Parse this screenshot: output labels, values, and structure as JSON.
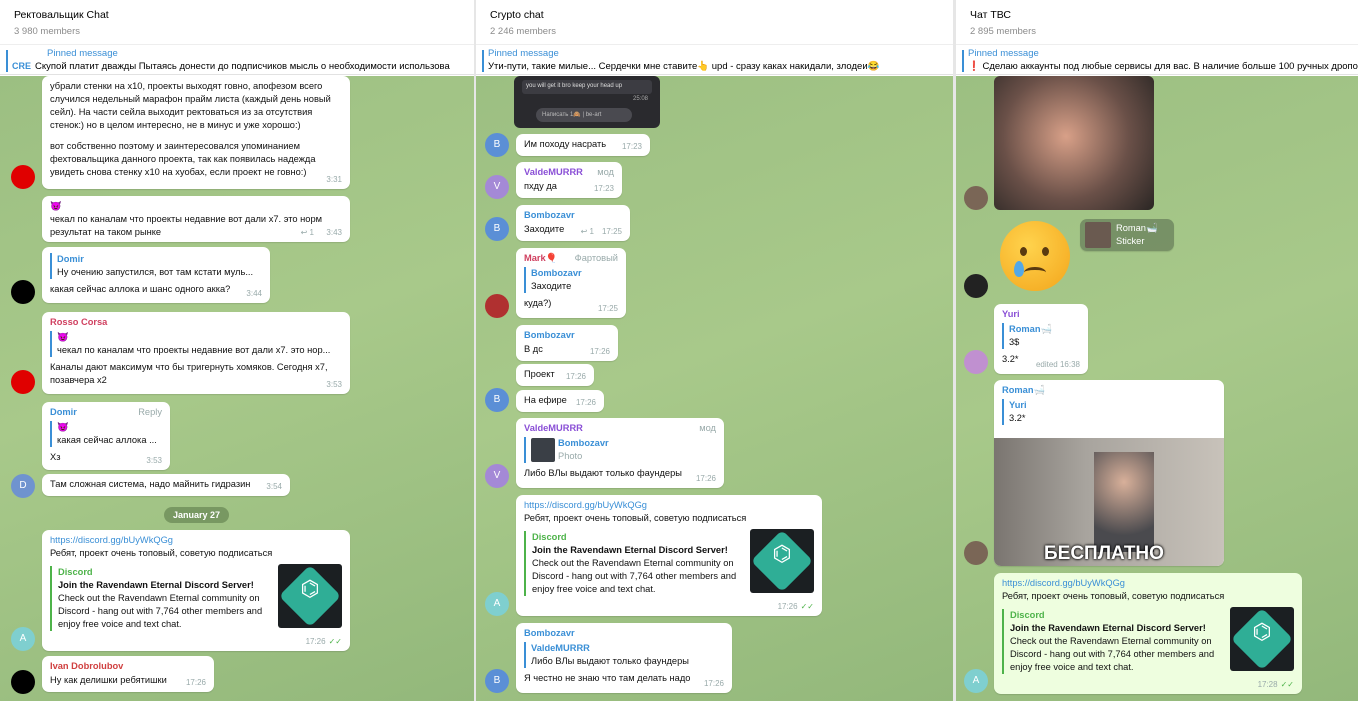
{
  "panel1": {
    "title": "Ректовальщик Chat",
    "members": "3 980 members",
    "pinned_label": "Pinned message",
    "pinned_logo": "CRE",
    "pinned_text": "Скупой платит дважды  Пытаясь донести до подписчиков мысль о необходимости использова",
    "m1_text": "убрали стенки на х10, проекты выходят говно, апофезом всего случился недельный марафон прайм листа (каждый день новый сейл). На части сейла выходит ректоваться из за отсутствия стенок:) но в целом интересно, не в минус и уже хорошо:)",
    "m1_text2": "вот собственно поэтому и заинтересовался упоминанием фехтовальщика данного проекта, так как появилась надежда увидеть снова стенку х10 на хуобах, если проект не говно:)",
    "m1_time": "3:31",
    "m2_emoji": "😈",
    "m2_text": "чекал по каналам что проекты недавние вот дали х7. это норм результат на таком рынке",
    "m2_reply": "1",
    "m2_time": "3:43",
    "m3_reply_name": "Domir",
    "m3_reply_text": "Ну очению запустился, вот там кстати муль...",
    "m3_text": "какая сейчас аллока и шанс одного акка?",
    "m3_time": "3:44",
    "m4_name": "Rosso Corsa",
    "m4_reply_emoji": "😈",
    "m4_reply_text": "чекал по каналам что проекты недавние вот дали х7. это нор...",
    "m4_text": "Каналы дают максимум что бы тригернуть хомяков. Сегодня х7, позавчера х2",
    "m4_time": "3:53",
    "m5_name": "Domir",
    "m5_action": "Reply",
    "m5_reply_emoji": "😈",
    "m5_reply_text": "какая сейчас аллока ...",
    "m5_text": "Хз",
    "m5_time": "3:53",
    "m6_text": "Там сложная система, надо майнить гидразин",
    "m6_time": "3:54",
    "m6_avatar": "D",
    "date": "January 27",
    "m7_link": "https://discord.gg/bUyWkQGg",
    "m7_text": "Ребят, проект очень топовый, советую подписаться",
    "m7_embed_site": "Discord",
    "m7_embed_title": "Join the Ravendawn Eternal Discord Server!",
    "m7_embed_desc": "Check out the Ravendawn Eternal community on Discord - hang out with 7,764 other members and enjoy free voice and text chat.",
    "m7_time": "17:26",
    "m7_avatar": "A",
    "m8_name": "Ivan Dobrolubov",
    "m8_text": "Ну как делишки ребятишки",
    "m8_time": "17:26"
  },
  "panel2": {
    "title": "Crypto chat",
    "members": "2 246 members",
    "pinned_label": "Pinned message",
    "pinned_text": "Ути-пути, такие милые... Сердечки мне ставите👆  upd - сразу каках накидали, злодеи😂",
    "shot_text": "you will get it bro keep your head up",
    "shot_time": "25:08",
    "shot_input": "Написать 1🙈 | be-art",
    "m1_text": "Им походу насрать",
    "m1_time": "17:23",
    "m1_avatar": "B",
    "m2_name": "ValdeMURRR",
    "m2_badge": "мод",
    "m2_text": "пхду да",
    "m2_time": "17:23",
    "m2_avatar": "V",
    "m3_name": "Bombozavr",
    "m3_text": "Заходите",
    "m3_reply": "1",
    "m3_time": "17:25",
    "m3_avatar": "B",
    "m4_name": "Mark🎈",
    "m4_badge": "Фартовый",
    "m4_reply_name": "Bombozavr",
    "m4_reply_text": "Заходите",
    "m4_text": "куда?)",
    "m4_time": "17:25",
    "m5_name": "Bombozavr",
    "m5_text": "В дс",
    "m5_time": "17:26",
    "m6_text": "Проект",
    "m6_time": "17:26",
    "m7_text": "На ефире",
    "m7_time": "17:26",
    "m7_avatar": "B",
    "m8_name": "ValdeMURRR",
    "m8_badge": "мод",
    "m8_reply_name": "Bombozavr",
    "m8_reply_text": "Photo",
    "m8_text": "Либо ВЛы выдают только фаундеры",
    "m8_time": "17:26",
    "m8_avatar": "V",
    "m9_link": "https://discord.gg/bUyWkQGg",
    "m9_text": "Ребят, проект очень топовый, советую подписаться",
    "m9_embed_site": "Discord",
    "m9_embed_title": "Join the Ravendawn Eternal Discord Server!",
    "m9_embed_desc": "Check out the Ravendawn Eternal community on Discord - hang out with 7,764 other members and enjoy free voice and text chat.",
    "m9_time": "17:26",
    "m9_avatar": "A",
    "m10_name": "Bombozavr",
    "m10_reply_name": "ValdeMURRR",
    "m10_reply_text": "Либо ВЛы выдают только фаундеры",
    "m10_text": "Я честно не знаю что там делать надо",
    "m10_time": "17:26",
    "m10_avatar": "B"
  },
  "panel3": {
    "title": "Чат ТВС",
    "members": "2 895 members",
    "pinned_label": "Pinned message",
    "pinned_text": "❗ Сделаю аккаунты под любые сервисы для вас. В наличие больше 100 ручных дропо",
    "sticker_reply_name": "Roman🛁",
    "sticker_reply_text": "Sticker",
    "m1_name": "Yuri",
    "m1_reply_name": "Roman🛁",
    "m1_reply_text": "3$",
    "m1_text": "3.2*",
    "m1_time": "edited 16:38",
    "m2_name": "Roman🛁",
    "m2_reply_name": "Yuri",
    "m2_reply_text": "3.2*",
    "m2_caption": "БЕСПЛАТНО",
    "m3_link": "https://discord.gg/bUyWkQGg",
    "m3_text": "Ребят, проект очень топовый, советую подписаться",
    "m3_embed_site": "Discord",
    "m3_embed_title": "Join the Ravendawn Eternal Discord Server!",
    "m3_embed_desc": "Check out the Ravendawn Eternal community on Discord - hang out with 7,764 other members and enjoy free voice and text chat.",
    "m3_time": "17:28",
    "m3_avatar": "A"
  },
  "colors": {
    "accent": "#3a8fd6",
    "discord_green": "#4eb34a",
    "chat_bg": "#a2c486"
  }
}
